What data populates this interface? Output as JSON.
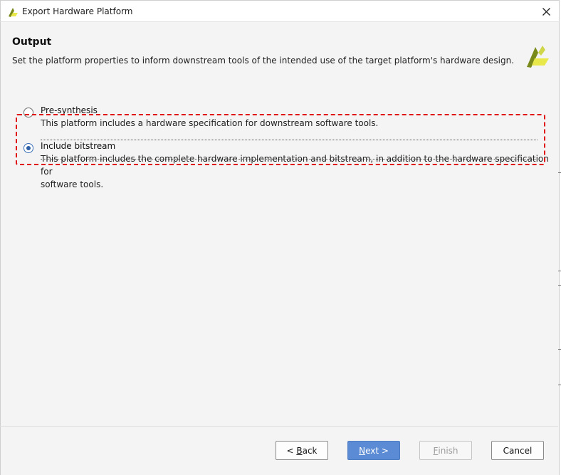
{
  "window": {
    "title": "Export Hardware Platform",
    "app_icon": "xilinx-logo-icon",
    "close_icon": "close-icon"
  },
  "header": {
    "title": "Output",
    "description": "Set the platform properties to inform downstream tools of the intended use of the target platform's hardware design.",
    "logo_icon": "xilinx-logo-icon"
  },
  "options": [
    {
      "label": "Pre-synthesis",
      "description": "This platform includes a hardware specification for downstream software tools.",
      "selected": false
    },
    {
      "label": "Include bitstream",
      "description_line1": "This platform includes the complete hardware implementation and bitstream, in addition to the hardware specification for",
      "description_line2": "software tools.",
      "selected": true
    }
  ],
  "buttons": {
    "back": {
      "prefix": "< ",
      "mnemonic": "B",
      "rest": "ack"
    },
    "next": {
      "mnemonic": "N",
      "rest": "ext >"
    },
    "finish": {
      "mnemonic": "F",
      "rest": "inish",
      "enabled": false
    },
    "cancel": {
      "label": "Cancel"
    }
  },
  "colors": {
    "accent": "#5b8bd4",
    "highlight": "#e01010",
    "logo_green": "#7a8a1a",
    "logo_yellow": "#e8e84a"
  }
}
